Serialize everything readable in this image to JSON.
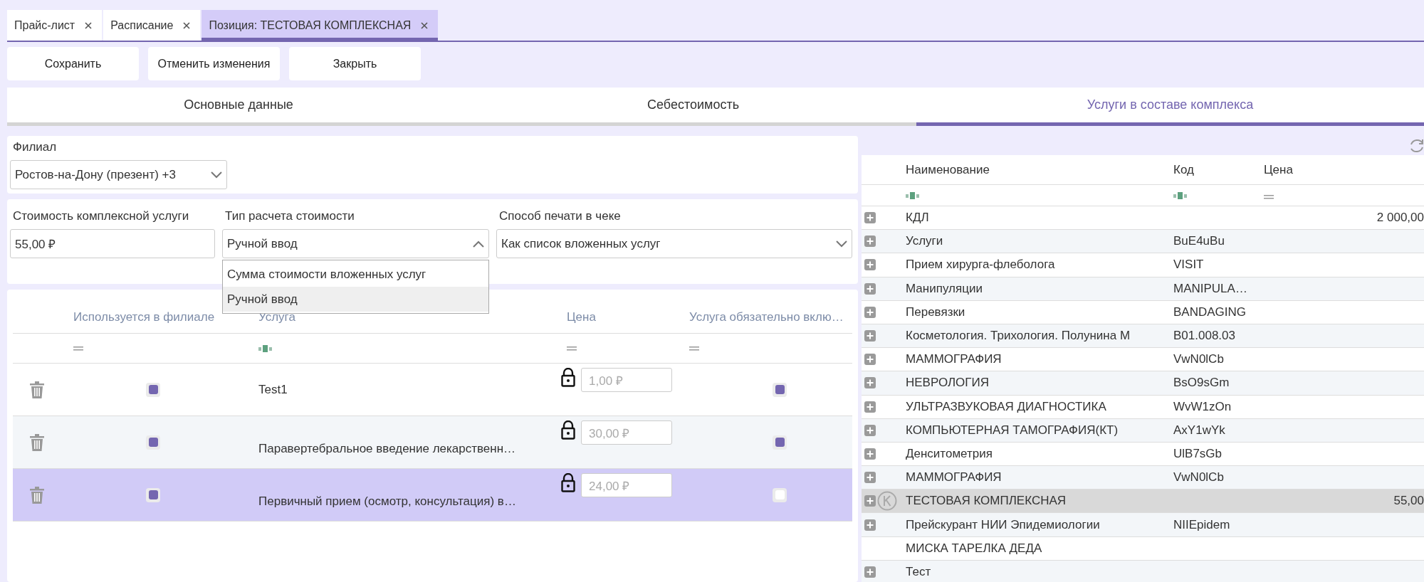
{
  "doc_tabs": [
    {
      "label": "Прайс-лист",
      "selected": false
    },
    {
      "label": "Расписание",
      "selected": false
    },
    {
      "label": "Позиция: ТЕСТОВАЯ КОМПЛЕКСНАЯ",
      "selected": true
    }
  ],
  "buttons": [
    "Сохранить",
    "Отменить изменения",
    "Закрыть"
  ],
  "section_tabs": [
    {
      "label": "Основные данные",
      "selected": false
    },
    {
      "label": "Себестоимость",
      "selected": false
    },
    {
      "label": "Услуги в составе комплекса",
      "selected": true
    }
  ],
  "branch": {
    "label": "Филиал",
    "value": "Ростов-на-Дону (презент) +3"
  },
  "cost_fields": [
    {
      "label": "Стоимость комплексной услуги",
      "value": "55,00 ₽",
      "kind": "input"
    },
    {
      "label": "Тип расчета стоимости",
      "value": "Ручной ввод",
      "kind": "select",
      "expanded": true,
      "options": [
        {
          "label": "Сумма стоимости вложенных услуг",
          "selected": false
        },
        {
          "label": "Ручной ввод",
          "selected": true
        }
      ]
    },
    {
      "label": "Способ печати в чеке",
      "value": "Как список вложенных услуг",
      "kind": "select",
      "expanded": false
    }
  ],
  "services_table": {
    "columns": [
      {
        "label": "Используется в филиале",
        "kind": "equals"
      },
      {
        "label": "Услуга",
        "kind": "text"
      },
      {
        "label": "Цена",
        "kind": "equals"
      },
      {
        "label": "Услуга обязательно вклю…",
        "kind": "equals"
      }
    ],
    "rows": [
      {
        "in_branch": true,
        "name": "Test1",
        "price": "1,00 ₽",
        "locked": true,
        "required": true,
        "selected": false
      },
      {
        "in_branch": true,
        "name": "Паравертебральное введение лекарственн…",
        "price": "30,00 ₽",
        "locked": true,
        "required": true,
        "selected": false
      },
      {
        "in_branch": true,
        "name": "Первичный прием (осмотр, консультация) в…",
        "price": "24,00 ₽",
        "locked": true,
        "required": false,
        "selected": true
      }
    ]
  },
  "catalog_table": {
    "columns": [
      {
        "label": "Наименование",
        "kind": "text"
      },
      {
        "label": "Код",
        "kind": "text"
      },
      {
        "label": "Цена",
        "kind": "equals"
      }
    ],
    "rows": [
      {
        "name": "КДЛ",
        "code": "",
        "price": "2 000,00",
        "expandable": true,
        "complex": false,
        "selected": false
      },
      {
        "name": "Услуги",
        "code": "BuE4uBu",
        "price": "",
        "expandable": true,
        "complex": false,
        "selected": false
      },
      {
        "name": "Прием хирурга-флеболога",
        "code": "VISIT",
        "price": "",
        "expandable": true,
        "complex": false,
        "selected": false
      },
      {
        "name": "Манипуляции",
        "code": "MANIPULA…",
        "price": "",
        "expandable": true,
        "complex": false,
        "selected": false
      },
      {
        "name": "Перевязки",
        "code": "BANDAGING",
        "price": "",
        "expandable": true,
        "complex": false,
        "selected": false
      },
      {
        "name": "Косметология. Трихология. Полунина М",
        "code": "B01.008.03",
        "price": "",
        "expandable": true,
        "complex": false,
        "selected": false
      },
      {
        "name": "МАММОГРАФИЯ",
        "code": "VwN0lCb",
        "price": "",
        "expandable": true,
        "complex": false,
        "selected": false
      },
      {
        "name": "НЕВРОЛОГИЯ",
        "code": "BsO9sGm",
        "price": "",
        "expandable": true,
        "complex": false,
        "selected": false
      },
      {
        "name": "УЛЬТРАЗВУКОВАЯ ДИАГНОСТИКА",
        "code": "WvW1zOn",
        "price": "",
        "expandable": true,
        "complex": false,
        "selected": false
      },
      {
        "name": "КОМПЬЮТЕРНАЯ ТАМОГРАФИЯ(КТ)",
        "code": "AxY1wYk",
        "price": "",
        "expandable": true,
        "complex": false,
        "selected": false
      },
      {
        "name": "Денситометрия",
        "code": "UlB7sGb",
        "price": "",
        "expandable": true,
        "complex": false,
        "selected": false
      },
      {
        "name": "МАММОГРАФИЯ",
        "code": "VwN0lCb",
        "price": "",
        "expandable": true,
        "complex": false,
        "selected": false
      },
      {
        "name": "ТЕСТОВАЯ КОМПЛЕКСНАЯ",
        "code": "",
        "price": "55,00",
        "expandable": true,
        "complex": true,
        "selected": true
      },
      {
        "name": "Прейскурант НИИ Эпидемиологии",
        "code": "NIIEpidem",
        "price": "",
        "expandable": true,
        "complex": false,
        "selected": false
      },
      {
        "name": "МИСКА ТАРЕЛКА ДЕДА",
        "code": "",
        "price": "",
        "expandable": false,
        "complex": false,
        "selected": false
      },
      {
        "name": "Тест",
        "code": "",
        "price": "",
        "expandable": true,
        "complex": false,
        "selected": false
      }
    ]
  }
}
